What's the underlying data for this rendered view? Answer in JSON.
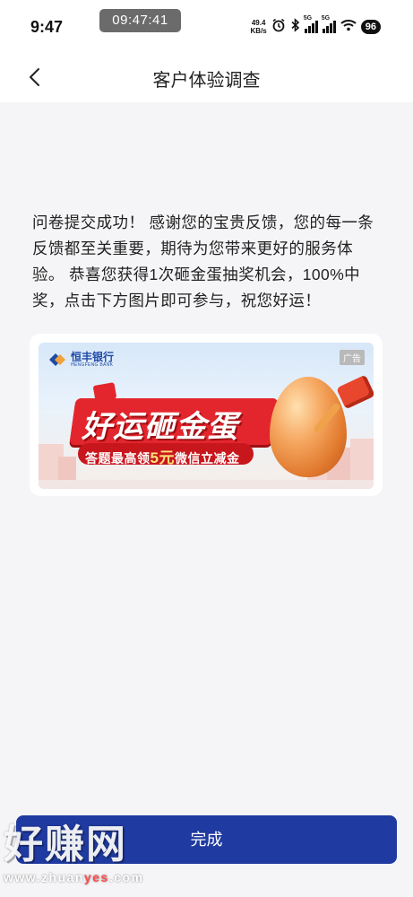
{
  "status_bar": {
    "time": "9:47",
    "clock_pill": "09:47:41",
    "net_speed_value": "49.4",
    "net_speed_unit": "KB/s",
    "signal1_gen": "5G",
    "signal2_gen": "5G",
    "battery": "96",
    "icons": [
      "alarm-icon",
      "bluetooth-icon",
      "signal-icon",
      "signal-icon",
      "wifi-icon",
      "battery-icon"
    ]
  },
  "navbar": {
    "title": "客户体验调查",
    "back_icon": "chevron-left-icon"
  },
  "message": {
    "text": "问卷提交成功！ 感谢您的宝贵反馈，您的每一条反馈都至关重要，期待为您带来更好的服务体验。 恭喜您获得1次砸金蛋抽奖机会，100%中奖，点击下方图片即可参与，祝您好运！"
  },
  "banner": {
    "bank_name": "恒丰银行",
    "bank_name_en": "HENGFENG BANK",
    "ad_tag": "广告",
    "promo_title": "好运砸金蛋",
    "promo_sub_pre": "答题最高领",
    "promo_sub_amount": "5元",
    "promo_sub_post": "微信立减金"
  },
  "footer": {
    "done_label": "完成"
  },
  "watermark": {
    "main": "好赚网",
    "url_pre": "www.zhuan",
    "url_accent": "yes",
    "url_post": ".com"
  },
  "colors": {
    "primary": "#1f3aa0",
    "background": "#f5f5f7",
    "promo_red": "#e3262d",
    "bank_blue": "#1f4aa6"
  }
}
